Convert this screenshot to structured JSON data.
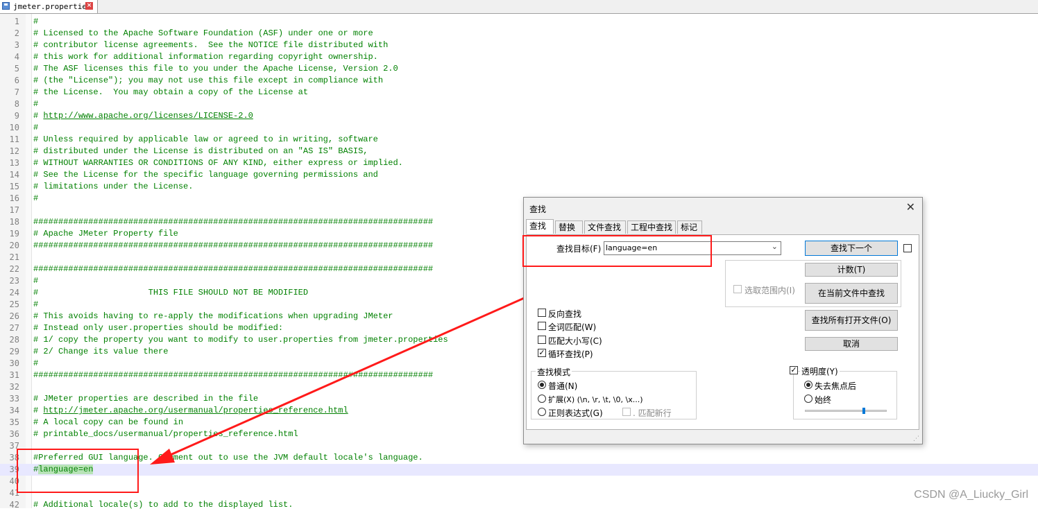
{
  "tab": {
    "file_name": "jmeter.properties"
  },
  "editor": {
    "lines": [
      {
        "n": "1",
        "text": "#"
      },
      {
        "n": "2",
        "text": "# Licensed to the Apache Software Foundation (ASF) under one or more"
      },
      {
        "n": "3",
        "text": "# contributor license agreements.  See the NOTICE file distributed with"
      },
      {
        "n": "4",
        "text": "# this work for additional information regarding copyright ownership."
      },
      {
        "n": "5",
        "text": "# The ASF licenses this file to you under the Apache License, Version 2.0"
      },
      {
        "n": "6",
        "text": "# (the \"License\"); you may not use this file except in compliance with"
      },
      {
        "n": "7",
        "text": "# the License.  You may obtain a copy of the License at"
      },
      {
        "n": "8",
        "text": "#"
      },
      {
        "n": "9",
        "text": "# http://www.apache.org/licenses/LICENSE-2.0"
      },
      {
        "n": "10",
        "text": "#"
      },
      {
        "n": "11",
        "text": "# Unless required by applicable law or agreed to in writing, software"
      },
      {
        "n": "12",
        "text": "# distributed under the License is distributed on an \"AS IS\" BASIS,"
      },
      {
        "n": "13",
        "text": "# WITHOUT WARRANTIES OR CONDITIONS OF ANY KIND, either express or implied."
      },
      {
        "n": "14",
        "text": "# See the License for the specific language governing permissions and"
      },
      {
        "n": "15",
        "text": "# limitations under the License."
      },
      {
        "n": "16",
        "text": "#"
      },
      {
        "n": "17",
        "text": ""
      },
      {
        "n": "18",
        "text": "################################################################################"
      },
      {
        "n": "19",
        "text": "# Apache JMeter Property file"
      },
      {
        "n": "20",
        "text": "################################################################################"
      },
      {
        "n": "21",
        "text": ""
      },
      {
        "n": "22",
        "text": "################################################################################"
      },
      {
        "n": "23",
        "text": "#"
      },
      {
        "n": "24",
        "text": "#                      THIS FILE SHOULD NOT BE MODIFIED"
      },
      {
        "n": "25",
        "text": "#"
      },
      {
        "n": "26",
        "text": "# This avoids having to re-apply the modifications when upgrading JMeter"
      },
      {
        "n": "27",
        "text": "# Instead only user.properties should be modified:"
      },
      {
        "n": "28",
        "text": "# 1/ copy the property you want to modify to user.properties from jmeter.properties"
      },
      {
        "n": "29",
        "text": "# 2/ Change its value there"
      },
      {
        "n": "30",
        "text": "#"
      },
      {
        "n": "31",
        "text": "################################################################################"
      },
      {
        "n": "32",
        "text": ""
      },
      {
        "n": "33",
        "text": "# JMeter properties are described in the file"
      },
      {
        "n": "34",
        "text": "# http://jmeter.apache.org/usermanual/properties_reference.html"
      },
      {
        "n": "35",
        "text": "# A local copy can be found in"
      },
      {
        "n": "36",
        "text": "# printable_docs/usermanual/properties_reference.html"
      },
      {
        "n": "37",
        "text": ""
      },
      {
        "n": "38",
        "text": "#Preferred GUI language. Comment out to use the JVM default locale's language."
      },
      {
        "n": "39",
        "text": "#language=en"
      },
      {
        "n": "40",
        "text": ""
      },
      {
        "n": "41",
        "text": ""
      },
      {
        "n": "42",
        "text": "# Additional locale(s) to add to the displayed list."
      }
    ],
    "link_line_34_url": "http://jmeter.apache.org/usermanual/properties_reference.html",
    "highlight_term": "language=en"
  },
  "dialog": {
    "title": "查找",
    "tabs": [
      "查找",
      "替换",
      "文件查找",
      "工程中查找",
      "标记"
    ],
    "find_label": "查找目标(F) :",
    "find_value": "language=en",
    "buttons": {
      "find_next": "查找下一个",
      "count": "计数(T)",
      "find_in_current": "在当前文件中查找",
      "find_all_open": "查找所有打开文件(O)",
      "cancel": "取消"
    },
    "in_selection": "选取范围内(I)",
    "options": {
      "backward": "反向查找",
      "whole_word": "全词匹配(W)",
      "match_case": "匹配大小写(C)",
      "wrap": "循环查找(P)"
    },
    "search_mode": {
      "title": "查找模式",
      "normal": "普通(N)",
      "extended": "扩展(X) (\\n, \\r, \\t, \\0, \\x...)",
      "regex": "正则表达式(G)",
      "dot_newline": ". 匹配新行"
    },
    "transparency": {
      "label": "透明度(Y)",
      "on_lose_focus": "失去焦点后",
      "always": "始终",
      "slider_level": 0.72
    }
  },
  "watermark": "CSDN @A_Liucky_Girl",
  "colors": {
    "annotation": "#ff1a1a",
    "comment": "#008000"
  }
}
